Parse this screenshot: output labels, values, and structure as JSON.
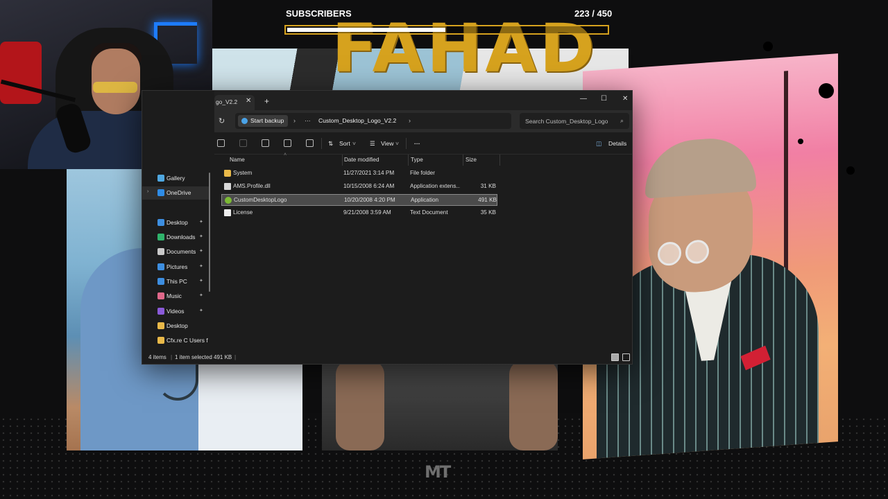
{
  "overlay": {
    "subscribers_label": "SUBSCRIBERS",
    "subscribers_current": 223,
    "subscribers_goal": 450,
    "subscribers_text": "223 / 450",
    "bar_color": "#d6a21e",
    "logo_text": "FAHAD",
    "watermark": "MT"
  },
  "window": {
    "tab_title": "go_V2.2",
    "tab_close_icon": "close-icon",
    "new_tab_icon": "plus-icon",
    "minimize_icon": "minimize-icon",
    "maximize_icon": "maximize-icon",
    "close_icon": "close-icon"
  },
  "address": {
    "refresh_icon": "refresh-icon",
    "backup_label": "Start backup",
    "more_label": "···",
    "folder": "Custom_Desktop_Logo_V2.2",
    "search_placeholder": "Search Custom_Desktop_Logo"
  },
  "toolbar": {
    "sort_label": "Sort",
    "view_label": "View",
    "more_label": "···",
    "details_label": "Details"
  },
  "nav": {
    "items": [
      {
        "label": "Gallery",
        "icon": "gallery-icon",
        "color": "#4fa7e0"
      },
      {
        "label": "OneDrive",
        "icon": "cloud-icon",
        "color": "#2f8ce6"
      },
      {
        "label": "Desktop",
        "icon": "desktop-icon",
        "color": "#3d8ee0"
      },
      {
        "label": "Downloads",
        "icon": "download-icon",
        "color": "#2fb36b"
      },
      {
        "label": "Documents",
        "icon": "document-icon",
        "color": "#c9c9c9"
      },
      {
        "label": "Pictures",
        "icon": "pictures-icon",
        "color": "#3d8ee0"
      },
      {
        "label": "This PC",
        "icon": "computer-icon",
        "color": "#3d8ee0"
      },
      {
        "label": "Music",
        "icon": "music-icon",
        "color": "#e0688a"
      },
      {
        "label": "Videos",
        "icon": "video-icon",
        "color": "#8a5ad8"
      },
      {
        "label": "Desktop",
        "icon": "folder-icon",
        "color": "#e9b949"
      },
      {
        "label": "Cfx.re  C  Users f",
        "icon": "folder-icon",
        "color": "#e9b949"
      }
    ]
  },
  "files": {
    "columns": [
      "Name",
      "Date modified",
      "Type",
      "Size"
    ],
    "rows": [
      {
        "name": "System",
        "date": "11/27/2021 3:14 PM",
        "type": "File folder",
        "size": "",
        "icon": "folder-icon"
      },
      {
        "name": "AMS.Profile.dll",
        "date": "10/15/2008 6:24 AM",
        "type": "Application extens...",
        "size": "31 KB",
        "icon": "dll-icon"
      },
      {
        "name": "CustomDesktopLogo",
        "date": "10/20/2008 4:20 PM",
        "type": "Application",
        "size": "491 KB",
        "icon": "app-icon"
      },
      {
        "name": "License",
        "date": "9/21/2008 3:59 AM",
        "type": "Text Document",
        "size": "35 KB",
        "icon": "text-file-icon"
      }
    ]
  },
  "status": {
    "item_count": "4 items",
    "selection": "1 item selected  491 KB",
    "sep": "|"
  }
}
